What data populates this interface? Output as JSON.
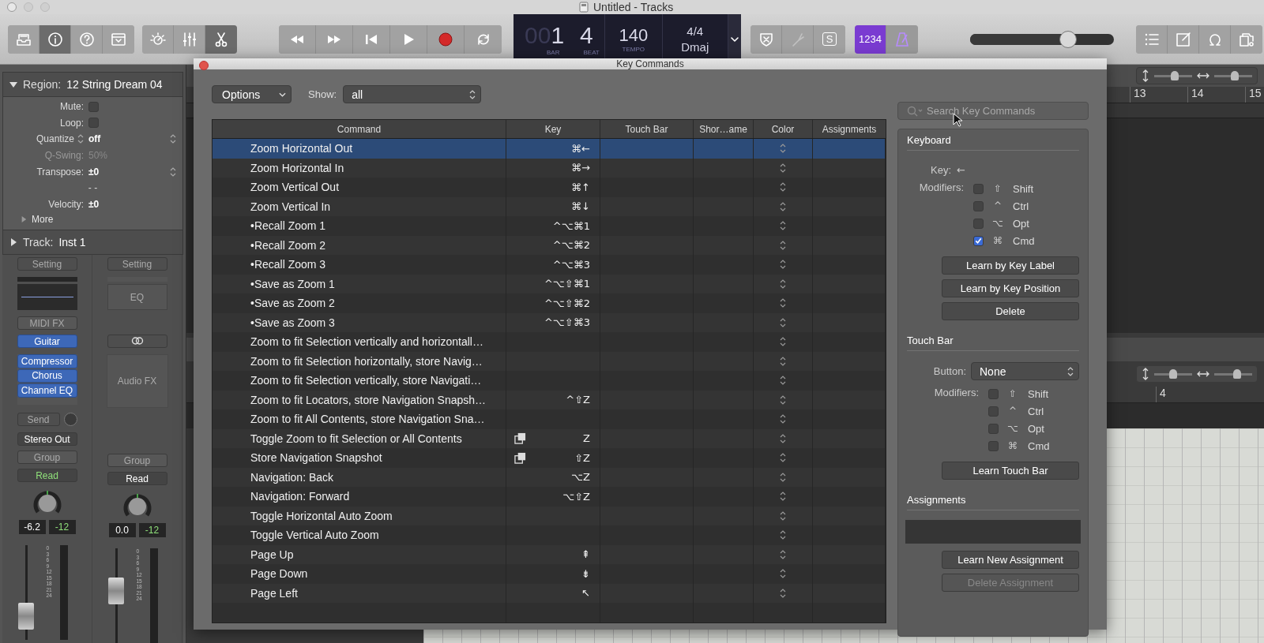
{
  "window": {
    "title": "Untitled - Tracks"
  },
  "toolbar": {
    "view_buttons": [
      {
        "selected": false
      },
      {
        "selected": true
      },
      {
        "selected": false
      },
      {
        "selected": false
      }
    ],
    "edit_buttons": [
      {
        "selected": false
      },
      {
        "selected": false
      },
      {
        "selected": true
      }
    ],
    "lcd": {
      "bar_dim": "00",
      "bar": "1",
      "beat": "4",
      "bar_label": "BAR",
      "beat_label": "BEAT",
      "tempo": "140",
      "tempo_label": "TEMPO",
      "signature": "4/4",
      "key": "Dmaj"
    },
    "mode_buttons": [
      {
        "disabled": false
      },
      {
        "disabled": true
      },
      {
        "disabled": false,
        "label": "S"
      }
    ],
    "count_in": {
      "label": "1234",
      "selected": true
    },
    "metronome": {
      "selected": true
    },
    "master_volume": {
      "level": 0.68
    }
  },
  "inspector": {
    "region": {
      "label": "Region:",
      "name": "12 String Dream 04",
      "expanded": true
    },
    "fields": [
      {
        "kind": "checkbox",
        "label": "Mute:",
        "checked": false,
        "disabled": false
      },
      {
        "kind": "checkbox",
        "label": "Loop:",
        "checked": false,
        "disabled": false
      },
      {
        "kind": "stepper",
        "label": "Quantize",
        "value": "off",
        "disabled": false
      },
      {
        "kind": "value",
        "label": "Q-Swing:",
        "value": "50%",
        "disabled": true
      },
      {
        "kind": "popup",
        "label": "Transpose:",
        "value": "±0",
        "disabled": false
      },
      {
        "kind": "value",
        "label": "- -",
        "disabled": false
      },
      {
        "kind": "value",
        "label": "Velocity:",
        "value": "±0",
        "disabled": false
      }
    ],
    "more": {
      "label": "More",
      "expanded": false
    },
    "track": {
      "label": "Track:",
      "name": "Inst 1",
      "expanded": false
    },
    "strips": [
      {
        "setting": "Setting",
        "midi_fx": "MIDI FX",
        "instrument": "Guitar",
        "plugins": [
          "Compressor",
          "Chorus",
          "Channel EQ"
        ],
        "send": "Send",
        "output": "Stereo Out",
        "group": "Group",
        "automation": "Read",
        "automation_on": true,
        "volume": "-6.2",
        "peak": "-12",
        "fader": {
          "level": 0.25
        },
        "scale": [
          "0",
          "3",
          "6",
          "9",
          "12",
          "15",
          "18",
          "21",
          "24"
        ]
      },
      {
        "setting": "Setting",
        "eq": "EQ",
        "audio_fx": "Audio FX",
        "group": "Group",
        "automation": "Read",
        "automation_on": false,
        "volume": "0.0",
        "peak": "-12",
        "fader": {
          "level": 0.55
        },
        "scale": [
          "0",
          "3",
          "6",
          "9",
          "12",
          "15",
          "18",
          "21",
          "24"
        ]
      }
    ]
  },
  "tracks": {
    "top_zoom": [
      {
        "level": 0.55
      },
      {
        "level": 0.55
      }
    ],
    "top_ruler": [
      "13",
      "14",
      "15"
    ],
    "bottom_zoom": [
      {
        "level": 0.5
      },
      {
        "level": 0.6
      }
    ],
    "bottom_ruler": [
      "4"
    ]
  },
  "dialog": {
    "title": "Key Commands",
    "options": "Options",
    "show_label": "Show:",
    "show_value": "all",
    "search_placeholder": "Search Key Commands",
    "table": {
      "columns": [
        "Command",
        "Key",
        "Touch Bar",
        "Shor…ame",
        "Color",
        "Assignments"
      ],
      "rows": [
        {
          "command": "Zoom Horizontal Out",
          "key": "⌘←",
          "touch_bar": false,
          "selected": true
        },
        {
          "command": "Zoom Horizontal In",
          "key": "⌘→",
          "touch_bar": false,
          "selected": false
        },
        {
          "command": "Zoom Vertical Out",
          "key": "⌘↑",
          "touch_bar": false,
          "selected": false
        },
        {
          "command": "Zoom Vertical In",
          "key": "⌘↓",
          "touch_bar": false,
          "selected": false
        },
        {
          "command": "•Recall Zoom 1",
          "key": "^⌥⌘1",
          "touch_bar": false,
          "selected": false
        },
        {
          "command": "•Recall Zoom 2",
          "key": "^⌥⌘2",
          "touch_bar": false,
          "selected": false
        },
        {
          "command": "•Recall Zoom 3",
          "key": "^⌥⌘3",
          "touch_bar": false,
          "selected": false
        },
        {
          "command": "•Save as Zoom 1",
          "key": "^⌥⇧⌘1",
          "touch_bar": false,
          "selected": false
        },
        {
          "command": "•Save as Zoom 2",
          "key": "^⌥⇧⌘2",
          "touch_bar": false,
          "selected": false
        },
        {
          "command": "•Save as Zoom 3",
          "key": "^⌥⇧⌘3",
          "touch_bar": false,
          "selected": false
        },
        {
          "command": "Zoom to fit Selection vertically and horizontall…",
          "touch_bar": false,
          "selected": false
        },
        {
          "command": "Zoom to fit Selection horizontally, store Navig…",
          "touch_bar": false,
          "selected": false
        },
        {
          "command": "Zoom to fit Selection vertically, store Navigati…",
          "touch_bar": false,
          "selected": false
        },
        {
          "command": "Zoom to fit Locators, store Navigation Snapsh…",
          "key": "^⇧Z",
          "touch_bar": false,
          "selected": false
        },
        {
          "command": "Zoom to fit All Contents, store Navigation Sna…",
          "touch_bar": false,
          "selected": false
        },
        {
          "command": "Toggle Zoom to fit Selection or All Contents",
          "key": "Z",
          "touch_bar": true,
          "selected": false
        },
        {
          "command": "Store Navigation Snapshot",
          "key": "⇧Z",
          "touch_bar": true,
          "selected": false
        },
        {
          "command": "Navigation: Back",
          "key": "⌥Z",
          "touch_bar": false,
          "selected": false
        },
        {
          "command": "Navigation: Forward",
          "key": "⌥⇧Z",
          "touch_bar": false,
          "selected": false
        },
        {
          "command": "Toggle Horizontal Auto Zoom",
          "touch_bar": false,
          "selected": false
        },
        {
          "command": "Toggle Vertical Auto Zoom",
          "touch_bar": false,
          "selected": false
        },
        {
          "command": "Page Up",
          "key": "⇞",
          "touch_bar": false,
          "selected": false
        },
        {
          "command": "Page Down",
          "key": "⇟",
          "touch_bar": false,
          "selected": false
        },
        {
          "command": "Page Left",
          "key": "↖",
          "touch_bar": false,
          "selected": false
        }
      ]
    },
    "keyboard": {
      "title": "Keyboard",
      "key_label": "Key:",
      "key": "←",
      "modifiers_label": "Modifiers:",
      "modifiers": [
        {
          "symbol": "⇧",
          "label": "Shift",
          "checked": false
        },
        {
          "symbol": "^",
          "label": "Ctrl",
          "checked": false
        },
        {
          "symbol": "⌥",
          "label": "Opt",
          "checked": false
        },
        {
          "symbol": "⌘",
          "label": "Cmd",
          "checked": true
        }
      ],
      "buttons": [
        {
          "label": "Learn by Key Label",
          "disabled": false
        },
        {
          "label": "Learn by Key Position",
          "disabled": false
        },
        {
          "label": "Delete",
          "disabled": false
        }
      ]
    },
    "touch_bar": {
      "title": "Touch Bar",
      "button_label": "Button:",
      "button_value": "None",
      "modifiers_label": "Modifiers:",
      "modifiers": [
        {
          "symbol": "⇧",
          "label": "Shift",
          "checked": false
        },
        {
          "symbol": "^",
          "label": "Ctrl",
          "checked": false
        },
        {
          "symbol": "⌥",
          "label": "Opt",
          "checked": false
        },
        {
          "symbol": "⌘",
          "label": "Cmd",
          "checked": false
        }
      ],
      "buttons": [
        {
          "label": "Learn Touch Bar",
          "disabled": false
        }
      ]
    },
    "assignments": {
      "title": "Assignments",
      "buttons": [
        {
          "label": "Learn New Assignment",
          "disabled": false
        },
        {
          "label": "Delete Assignment",
          "disabled": true
        }
      ]
    }
  }
}
